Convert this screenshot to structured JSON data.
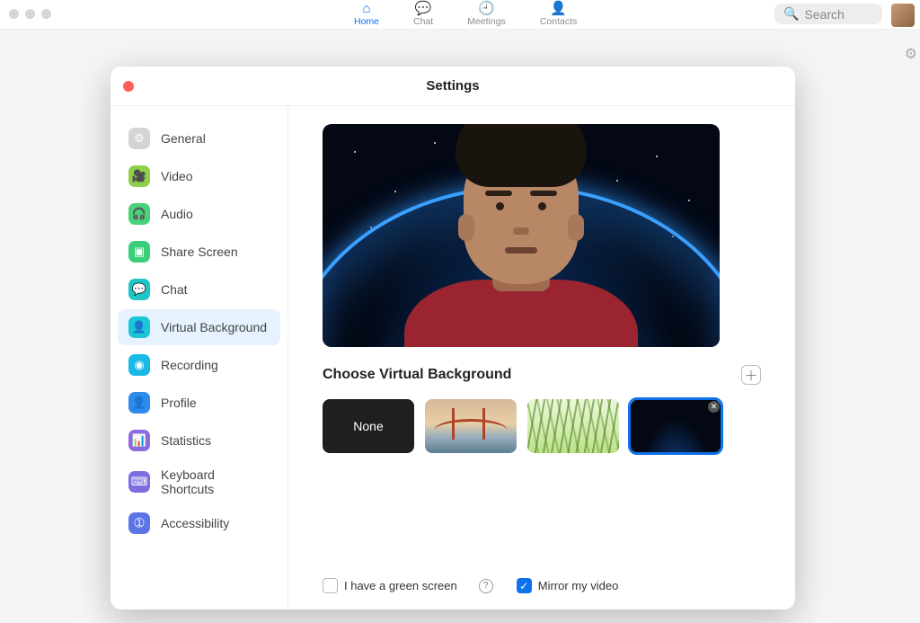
{
  "topnav": {
    "tabs": [
      {
        "label": "Home",
        "icon": "home-icon",
        "active": true
      },
      {
        "label": "Chat",
        "icon": "chat-icon",
        "active": false
      },
      {
        "label": "Meetings",
        "icon": "clock-icon",
        "active": false
      },
      {
        "label": "Contacts",
        "icon": "contacts-icon",
        "active": false
      }
    ],
    "search_placeholder": "Search"
  },
  "modal": {
    "title": "Settings",
    "sidebar": [
      {
        "label": "General",
        "icon": "gear-icon",
        "color": "#d4d4d4",
        "glyph": "⚙"
      },
      {
        "label": "Video",
        "icon": "video-icon",
        "color": "#8fd04a",
        "glyph": "🎥"
      },
      {
        "label": "Audio",
        "icon": "headphones-icon",
        "color": "#48d27a",
        "glyph": "🎧"
      },
      {
        "label": "Share Screen",
        "icon": "share-screen-icon",
        "color": "#39cf7a",
        "glyph": "▣"
      },
      {
        "label": "Chat",
        "icon": "chat-icon",
        "color": "#1fc6c6",
        "glyph": "💬"
      },
      {
        "label": "Virtual Background",
        "icon": "virtual-bg-icon",
        "color": "#1bc7d5",
        "glyph": "👤",
        "active": true
      },
      {
        "label": "Recording",
        "icon": "record-icon",
        "color": "#19b9e6",
        "glyph": "◉"
      },
      {
        "label": "Profile",
        "icon": "profile-icon",
        "color": "#2f8bea",
        "glyph": "👤"
      },
      {
        "label": "Statistics",
        "icon": "stats-icon",
        "color": "#8e6ae0",
        "glyph": "📊"
      },
      {
        "label": "Keyboard Shortcuts",
        "icon": "keyboard-icon",
        "color": "#7c6de0",
        "glyph": "⌨"
      },
      {
        "label": "Accessibility",
        "icon": "accessibility-icon",
        "color": "#5b74e6",
        "glyph": "➀"
      }
    ],
    "section_title": "Choose Virtual Background",
    "thumbnails": [
      {
        "label": "None",
        "type": "none",
        "selected": false
      },
      {
        "label": "Golden Gate Bridge",
        "type": "bridge",
        "selected": false
      },
      {
        "label": "Grass",
        "type": "grass",
        "selected": false
      },
      {
        "label": "Earth from space",
        "type": "earth",
        "selected": true
      }
    ],
    "checkboxes": {
      "green_screen": {
        "label": "I have a green screen",
        "checked": false
      },
      "mirror": {
        "label": "Mirror my video",
        "checked": true
      }
    }
  }
}
